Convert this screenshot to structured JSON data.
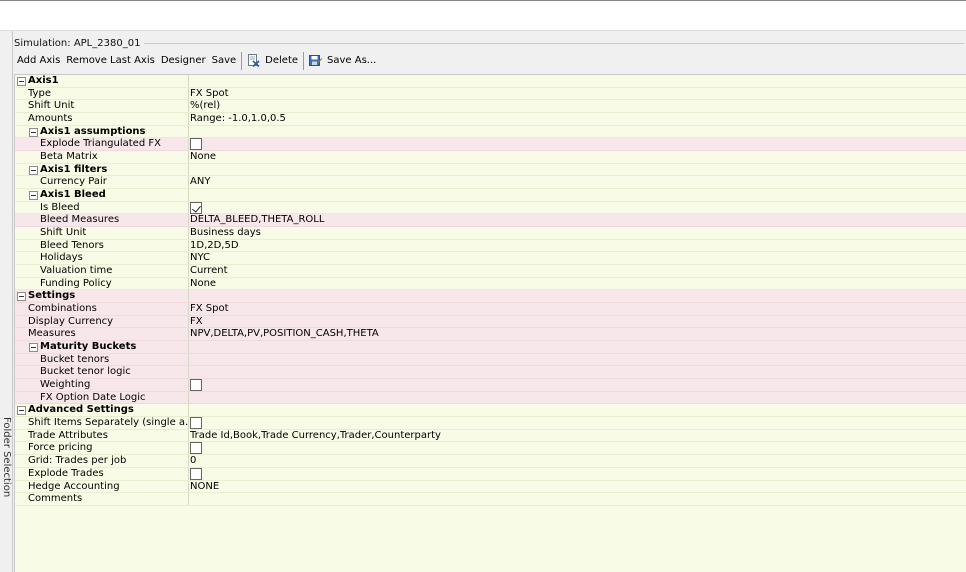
{
  "window": {
    "simulation_title": "Simulation: APL_2380_01"
  },
  "side_panel": {
    "label": "Folder Selection"
  },
  "toolbar": {
    "add_axis": "Add Axis",
    "remove_last_axis": "Remove Last Axis",
    "designer": "Designer",
    "save": "Save",
    "delete": "Delete",
    "save_as": "Save As..."
  },
  "colors": {
    "grid_yellow": "#f8fce6",
    "grid_pink": "#f8e7ea"
  },
  "rows": [
    {
      "label": "Axis1",
      "value": "",
      "level": 0,
      "group": true,
      "shade": "yellow"
    },
    {
      "label": "Type",
      "value": "FX Spot",
      "level": 1,
      "shade": "yellow"
    },
    {
      "label": "Shift Unit",
      "value": "%(rel)",
      "level": 1,
      "shade": "yellow"
    },
    {
      "label": "Amounts",
      "value": "Range: -1.0,1.0,0.5",
      "level": 1,
      "shade": "yellow"
    },
    {
      "label": "Axis1 assumptions",
      "value": "",
      "level": 1,
      "group": true,
      "shade": "yellow"
    },
    {
      "label": "Explode Triangulated FX",
      "value": "",
      "checkbox": true,
      "checked": false,
      "level": 2,
      "shade": "pink"
    },
    {
      "label": "Beta Matrix",
      "value": "None",
      "level": 2,
      "shade": "yellow"
    },
    {
      "label": "Axis1 filters",
      "value": "",
      "level": 1,
      "group": true,
      "shade": "yellow"
    },
    {
      "label": "Currency Pair",
      "value": "ANY",
      "level": 2,
      "shade": "yellow"
    },
    {
      "label": "Axis1 Bleed",
      "value": "",
      "level": 1,
      "group": true,
      "shade": "yellow"
    },
    {
      "label": "Is Bleed",
      "value": "",
      "checkbox": true,
      "checked": true,
      "level": 2,
      "shade": "yellow"
    },
    {
      "label": "Bleed Measures",
      "value": "DELTA_BLEED,THETA_ROLL",
      "level": 2,
      "shade": "pink"
    },
    {
      "label": "Shift Unit",
      "value": "Business days",
      "level": 2,
      "shade": "yellow"
    },
    {
      "label": "Bleed Tenors",
      "value": "1D,2D,5D",
      "level": 2,
      "shade": "yellow"
    },
    {
      "label": "Holidays",
      "value": "NYC",
      "level": 2,
      "shade": "yellow"
    },
    {
      "label": "Valuation time",
      "value": "Current",
      "level": 2,
      "shade": "yellow"
    },
    {
      "label": "Funding Policy",
      "value": "None",
      "level": 2,
      "shade": "yellow"
    },
    {
      "label": "Settings",
      "value": "",
      "level": 0,
      "group": true,
      "shade": "pink"
    },
    {
      "label": "Combinations",
      "value": "FX Spot",
      "level": 1,
      "shade": "pink"
    },
    {
      "label": "Display Currency",
      "value": "FX",
      "level": 1,
      "shade": "pink"
    },
    {
      "label": "Measures",
      "value": "NPV,DELTA,PV,POSITION_CASH,THETA",
      "level": 1,
      "shade": "pink"
    },
    {
      "label": "Maturity Buckets",
      "value": "",
      "level": 1,
      "group": true,
      "shade": "pink"
    },
    {
      "label": "Bucket tenors",
      "value": "",
      "level": 2,
      "shade": "pink"
    },
    {
      "label": "Bucket tenor logic",
      "value": "",
      "level": 2,
      "shade": "pink"
    },
    {
      "label": "Weighting",
      "value": "",
      "checkbox": true,
      "checked": false,
      "level": 2,
      "shade": "pink"
    },
    {
      "label": "FX Option Date Logic",
      "value": "",
      "level": 2,
      "shade": "pink"
    },
    {
      "label": "Advanced Settings",
      "value": "",
      "level": 0,
      "group": true,
      "shade": "yellow"
    },
    {
      "label": "Shift Items Separately (single a...",
      "value": "",
      "checkbox": true,
      "checked": false,
      "level": 1,
      "shade": "yellow"
    },
    {
      "label": "Trade Attributes",
      "value": "Trade Id,Book,Trade Currency,Trader,Counterparty",
      "level": 1,
      "shade": "yellow"
    },
    {
      "label": "Force pricing",
      "value": "",
      "checkbox": true,
      "checked": false,
      "level": 1,
      "shade": "yellow"
    },
    {
      "label": "Grid: Trades per job",
      "value": "0",
      "level": 1,
      "shade": "yellow"
    },
    {
      "label": "Explode Trades",
      "value": "",
      "checkbox": true,
      "checked": false,
      "level": 1,
      "shade": "yellow"
    },
    {
      "label": "Hedge Accounting",
      "value": "NONE",
      "level": 1,
      "shade": "yellow"
    },
    {
      "label": "Comments",
      "value": "",
      "level": 1,
      "shade": "yellow"
    }
  ]
}
